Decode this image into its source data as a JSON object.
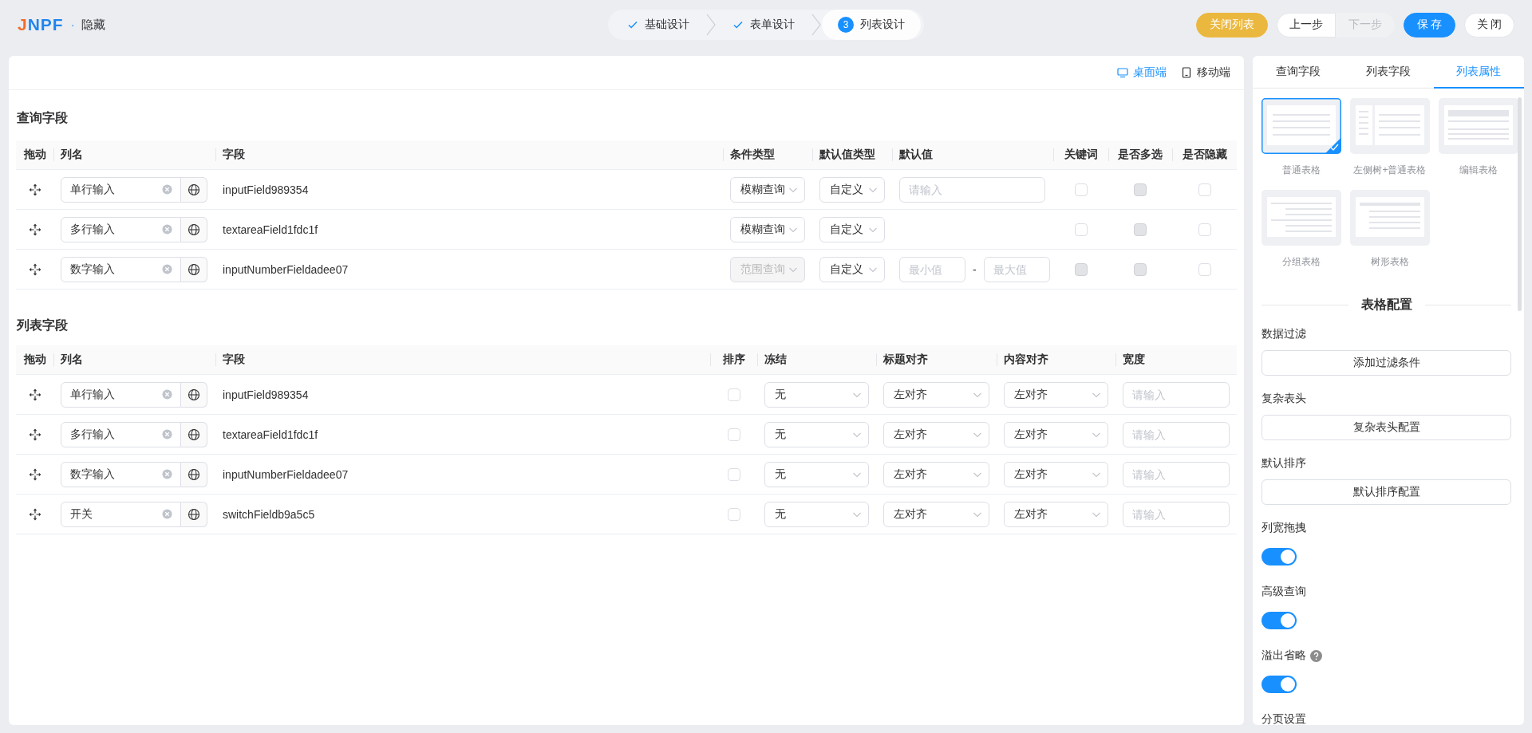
{
  "header": {
    "logo": "JNPF",
    "separator": "·",
    "title": "隐藏",
    "steps": [
      {
        "label": "基础设计",
        "completed": true
      },
      {
        "label": "表单设计",
        "completed": true
      },
      {
        "label": "列表设计",
        "completed": false,
        "number": "3"
      }
    ],
    "buttons": [
      {
        "label": "关闭列表",
        "kind": "warning",
        "disabled": false
      },
      {
        "label": "上一步",
        "kind": "group",
        "disabled": false
      },
      {
        "label": "下一步",
        "kind": "group",
        "disabled": true
      },
      {
        "label": "保 存",
        "kind": "primary",
        "disabled": false
      },
      {
        "label": "关 闭",
        "kind": "default",
        "disabled": false
      }
    ]
  },
  "device_switch": [
    {
      "label": "桌面端",
      "kind": "desktop",
      "selected": true
    },
    {
      "label": "移动端",
      "kind": "mobile",
      "selected": false
    }
  ],
  "query": {
    "title": "查询字段",
    "columns": [
      "拖动",
      "列名",
      "字段",
      "条件类型",
      "默认值类型",
      "默认值",
      "关键词",
      "是否多选",
      "是否隐藏"
    ],
    "rows": [
      {
        "name": "单行输入",
        "field": "inputField989354",
        "condition": {
          "value": "模糊查询",
          "disabled": false
        },
        "default_type": "自定义",
        "default_value": {
          "kind": "text",
          "placeholder": "请输入"
        },
        "keyword": {
          "checked": false,
          "disabled": false
        },
        "multiple": {
          "checked": false,
          "disabled": true
        },
        "hidden": {
          "checked": false,
          "disabled": false
        }
      },
      {
        "name": "多行输入",
        "field": "textareaField1fdc1f",
        "condition": {
          "value": "模糊查询",
          "disabled": false
        },
        "default_type": "自定义",
        "default_value": {
          "kind": "none"
        },
        "keyword": {
          "checked": false,
          "disabled": false
        },
        "multiple": {
          "checked": false,
          "disabled": true
        },
        "hidden": {
          "checked": false,
          "disabled": false
        }
      },
      {
        "name": "数字输入",
        "field": "inputNumberFieldadee07",
        "condition": {
          "value": "范围查询",
          "disabled": true
        },
        "default_type": "自定义",
        "default_value": {
          "kind": "range",
          "min_placeholder": "最小值",
          "separator": "-",
          "max_placeholder": "最大值"
        },
        "keyword": {
          "checked": false,
          "disabled": true
        },
        "multiple": {
          "checked": false,
          "disabled": true
        },
        "hidden": {
          "checked": false,
          "disabled": false
        }
      }
    ]
  },
  "list": {
    "title": "列表字段",
    "columns": [
      "拖动",
      "列名",
      "字段",
      "排序",
      "冻结",
      "标题对齐",
      "内容对齐",
      "宽度"
    ],
    "rows": [
      {
        "name": "单行输入",
        "field": "inputField989354",
        "sort": {
          "checked": false,
          "disabled": false
        },
        "freeze": "无",
        "title_align": "左对齐",
        "content_align": "左对齐",
        "width_placeholder": "请输入"
      },
      {
        "name": "多行输入",
        "field": "textareaField1fdc1f",
        "sort": {
          "checked": false,
          "disabled": false
        },
        "freeze": "无",
        "title_align": "左对齐",
        "content_align": "左对齐",
        "width_placeholder": "请输入"
      },
      {
        "name": "数字输入",
        "field": "inputNumberFieldadee07",
        "sort": {
          "checked": false,
          "disabled": false
        },
        "freeze": "无",
        "title_align": "左对齐",
        "content_align": "左对齐",
        "width_placeholder": "请输入"
      },
      {
        "name": "开关",
        "field": "switchFieldb9a5c5",
        "sort": {
          "checked": false,
          "disabled": false
        },
        "freeze": "无",
        "title_align": "左对齐",
        "content_align": "左对齐",
        "width_placeholder": "请输入"
      }
    ]
  },
  "panel": {
    "tabs": [
      {
        "label": "查询字段",
        "selected": false
      },
      {
        "label": "列表字段",
        "selected": false
      },
      {
        "label": "列表属性",
        "selected": true
      }
    ],
    "layouts": [
      {
        "label": "普通表格",
        "kind": "plain",
        "selected": true
      },
      {
        "label": "左侧树+普通表格",
        "kind": "tree",
        "selected": false
      },
      {
        "label": "编辑表格",
        "kind": "edit",
        "selected": false
      },
      {
        "label": "分组表格",
        "kind": "group",
        "selected": false
      },
      {
        "label": "树形表格",
        "kind": "treetable",
        "selected": false
      }
    ],
    "config_title": "表格配置",
    "settings": [
      {
        "kind": "button",
        "label": "数据过滤",
        "button": "添加过滤条件",
        "help": false
      },
      {
        "kind": "button",
        "label": "复杂表头",
        "button": "复杂表头配置",
        "help": false
      },
      {
        "kind": "button",
        "label": "默认排序",
        "button": "默认排序配置",
        "help": false
      },
      {
        "kind": "switch",
        "label": "列宽拖拽",
        "on": true,
        "help": false
      },
      {
        "kind": "switch",
        "label": "高级查询",
        "on": true,
        "help": false
      },
      {
        "kind": "switch",
        "label": "溢出省略",
        "on": true,
        "help": true
      },
      {
        "kind": "label",
        "label": "分页设置",
        "help": false
      }
    ]
  }
}
